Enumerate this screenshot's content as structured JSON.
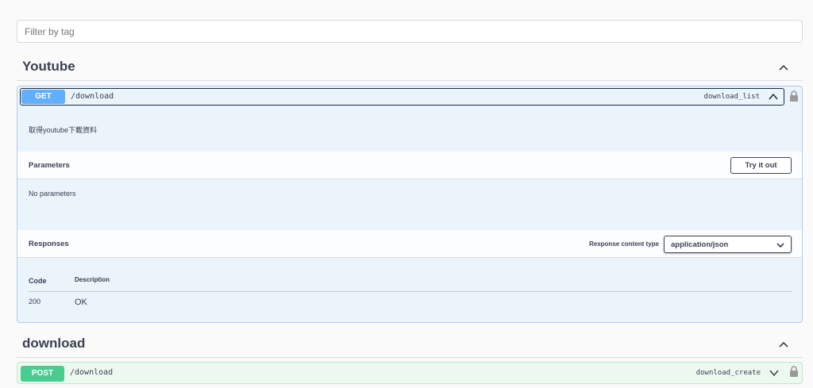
{
  "filter": {
    "placeholder": "Filter by tag"
  },
  "tags": [
    {
      "name": "Youtube",
      "operation": {
        "method": "GET",
        "path": "/download",
        "operation_id": "download_list",
        "description": "取得youtube下載資料",
        "parameters": {
          "title": "Parameters",
          "try_button": "Try it out",
          "empty_text": "No parameters"
        },
        "responses": {
          "title": "Responses",
          "content_type_label": "Response content type",
          "content_type_value": "application/json",
          "columns": {
            "code": "Code",
            "description": "Description"
          },
          "rows": [
            {
              "code": "200",
              "description": "OK"
            }
          ]
        }
      }
    },
    {
      "name": "download",
      "operation": {
        "method": "POST",
        "path": "/download",
        "operation_id": "download_create"
      }
    }
  ],
  "colors": {
    "get": "#61affe",
    "post": "#49cc90"
  },
  "icons": [
    "chevron-up-icon",
    "chevron-down-icon",
    "lock-icon"
  ]
}
